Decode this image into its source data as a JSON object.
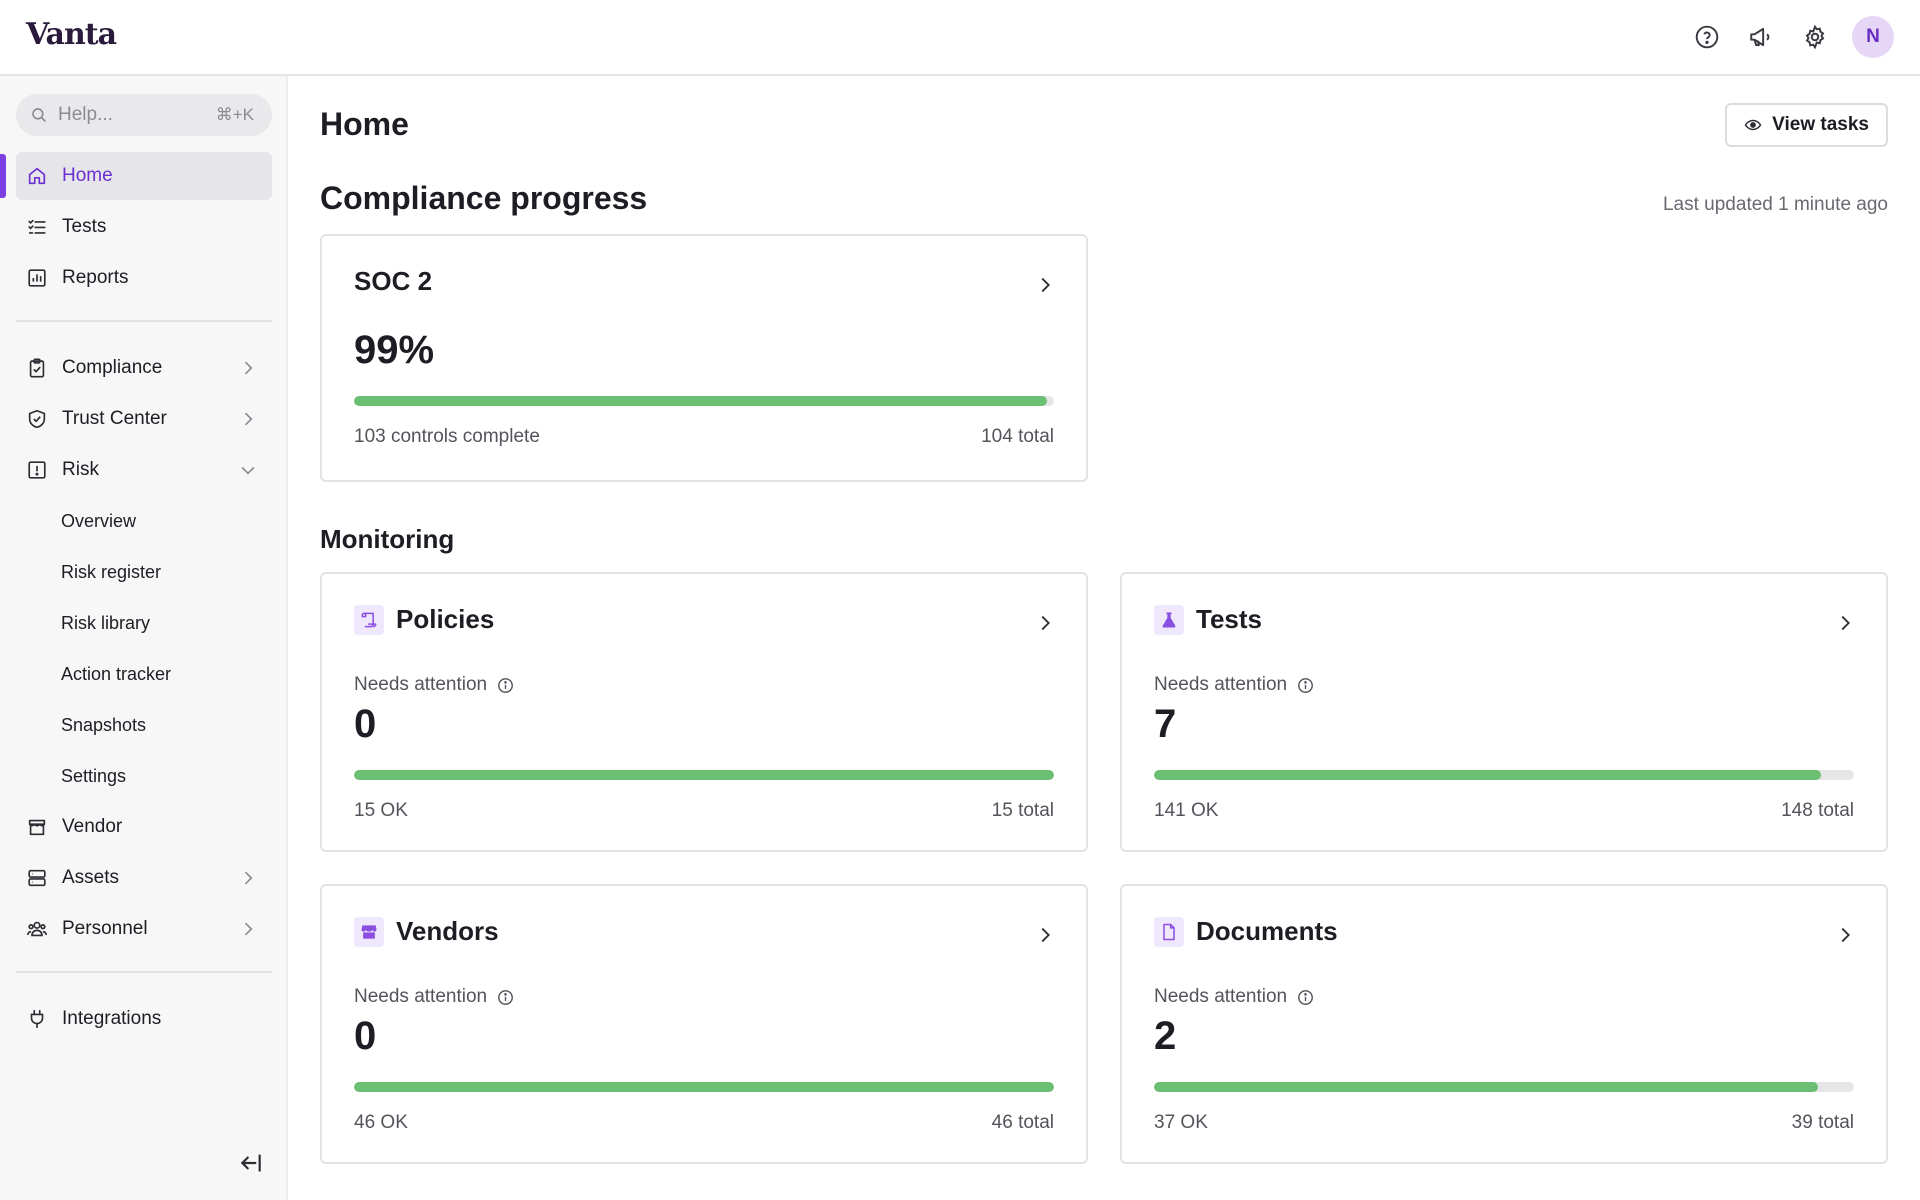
{
  "app": {
    "logo": "Vanta",
    "avatar_initial": "N"
  },
  "colors": {
    "accent": "#7b3fe4",
    "progress": "#6bbf72"
  },
  "search": {
    "placeholder": "Help...",
    "shortcut": "⌘+K"
  },
  "sidebar": {
    "home": "Home",
    "tests": "Tests",
    "reports": "Reports",
    "compliance": "Compliance",
    "trust_center": "Trust Center",
    "risk": "Risk",
    "risk_sub": [
      "Overview",
      "Risk register",
      "Risk library",
      "Action tracker",
      "Snapshots",
      "Settings"
    ],
    "vendor": "Vendor",
    "assets": "Assets",
    "personnel": "Personnel",
    "integrations": "Integrations"
  },
  "main": {
    "title": "Home",
    "view_tasks": "View tasks",
    "compliance_title": "Compliance progress",
    "last_updated": "Last updated 1 minute ago",
    "monitoring_title": "Monitoring"
  },
  "soc2": {
    "title": "SOC 2",
    "percent": "99%",
    "progress": 0.99,
    "left": "103 controls complete",
    "right": "104 total"
  },
  "monitoring": {
    "policies": {
      "title": "Policies",
      "needs_label": "Needs attention",
      "count": "0",
      "progress": 1.0,
      "ok": "15 OK",
      "total": "15 total"
    },
    "tests": {
      "title": "Tests",
      "needs_label": "Needs attention",
      "count": "7",
      "progress": 0.953,
      "ok": "141 OK",
      "total": "148 total"
    },
    "vendors": {
      "title": "Vendors",
      "needs_label": "Needs attention",
      "count": "0",
      "progress": 1.0,
      "ok": "46 OK",
      "total": "46 total"
    },
    "documents": {
      "title": "Documents",
      "needs_label": "Needs attention",
      "count": "2",
      "progress": 0.949,
      "ok": "37 OK",
      "total": "39 total"
    }
  }
}
